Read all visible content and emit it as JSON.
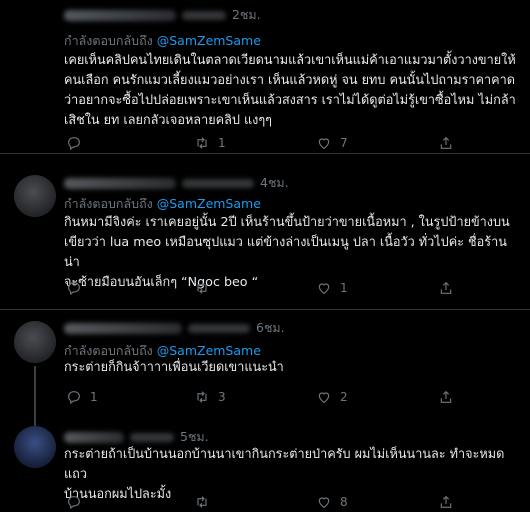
{
  "tweets": [
    {
      "time": "2ชม.",
      "reply_prefix": "กำลังตอบกลับถึง",
      "mention": "@SamZemSame",
      "lines": [
        "เคยเห็นคลิปคนไทยเดินในตลาดเวียดนามแล้วเขาเห็นแม่ค้าเอาแมวมาตั้งวางขายให้",
        "คนเลือก คนรักแมวเลี้ยงแมวอย่างเรา เห็นแล้วหดหู่ จน ยทบ คนนั้นไปถามราคาคาด",
        "ว่าอยากจะซื้อไปปล่อยเพราะเขาเห็นแล้วสงสาร เราไม่ได้ดูต่อไม่รู้เขาซื้อไหม ไม่กล้า",
        "เสิชใน ยท เลยกลัวเจอหลายคลิป แงๆๆ"
      ],
      "replies": "",
      "retweets": "1",
      "likes": "7"
    },
    {
      "time": "4ชม.",
      "reply_prefix": "กำลังตอบกลับถึง",
      "mention": "@SamZemSame",
      "lines": [
        "กินหมามีจิงค่ะ เราเคยอยู่นั้น 2ปี เห็นร้านขึ้นป้ายว่าขายเนื้อหมา , ในรูปป้ายข้างบน",
        "เขียวว่า lua meo เหมือนซุปแมว แต่ข้างล่างเป็นเมนู ปลา เนื้อวัว ทั่วไปค่ะ ชื่อร้านน่า",
        "จะซ้ายมือบนอันเล็กๆ “Ngoc beo “"
      ],
      "replies": "",
      "retweets": "",
      "likes": "1"
    },
    {
      "time": "6ชม.",
      "reply_prefix": "กำลังตอบกลับถึง",
      "mention": "@SamZemSame",
      "lines": [
        "กระต่ายก็กินจ้าาาาเพื่อนเวียดเขาแนะนำ"
      ],
      "replies": "1",
      "retweets": "3",
      "likes": "2"
    },
    {
      "time": "5ชม.",
      "reply_prefix": "",
      "mention": "",
      "lines": [
        "กระต่ายถ้าเป็นบ้านนอกบ้านนาเขากินกระต่ายป่าครับ ผมไม่เห็นนานละ ทำจะหมดแถว",
        "บ้านนอกผมไปละมั้ง"
      ],
      "replies": "",
      "retweets": "",
      "likes": "8"
    }
  ]
}
